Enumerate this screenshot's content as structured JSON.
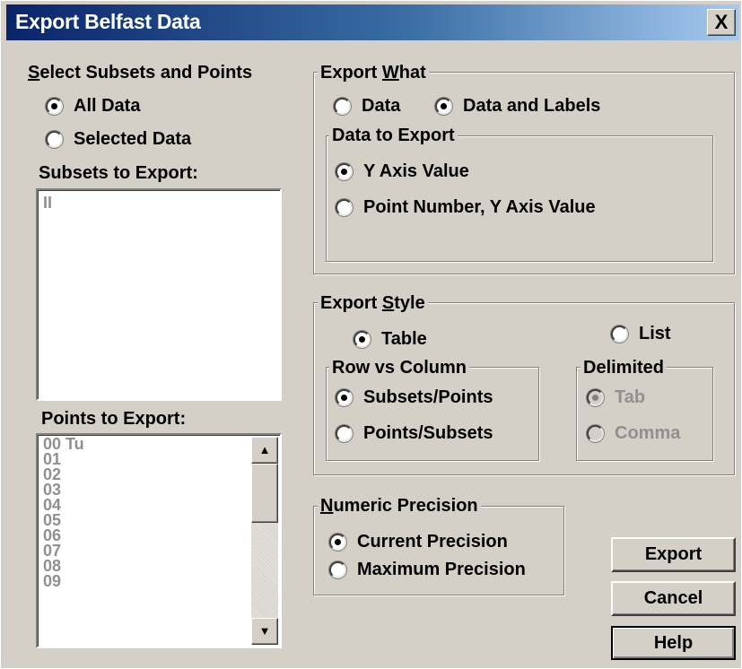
{
  "window": {
    "title": "Export Belfast Data",
    "close_symbol": "X"
  },
  "subsets_points": {
    "group_label_first": "S",
    "group_label_rest": "elect Subsets and Points",
    "all_data": "All Data",
    "selected_data": "Selected Data",
    "subsets_label": "Subsets to Export:",
    "subsets_items": [
      "II"
    ],
    "points_label": "Points to Export:",
    "points_items": [
      "00 Tu",
      "01",
      "02",
      "03",
      "04",
      "05",
      "06",
      "07",
      "08",
      "09"
    ]
  },
  "export_what": {
    "label_pre": "Export ",
    "label_u": "W",
    "label_post": "hat",
    "data": "Data",
    "data_and_labels": "Data and Labels",
    "data_to_export": {
      "label": "Data to Export",
      "y_axis": "Y Axis Value",
      "point_number_y": "Point Number, Y Axis Value"
    }
  },
  "export_style": {
    "label_pre": "Export ",
    "label_u": "S",
    "label_post": "tyle",
    "table": "Table",
    "list": "List",
    "row_vs_column": {
      "label": "Row vs Column",
      "subsets_points": "Subsets/Points",
      "points_subsets": "Points/Subsets"
    },
    "delimited": {
      "label": "Delimited",
      "tab": "Tab",
      "comma": "Comma"
    }
  },
  "precision": {
    "label_u": "N",
    "label_post": "umeric Precision",
    "current": "Current Precision",
    "maximum": "Maximum Precision"
  },
  "buttons": {
    "export": "Export",
    "cancel": "Cancel",
    "help": "Help"
  }
}
